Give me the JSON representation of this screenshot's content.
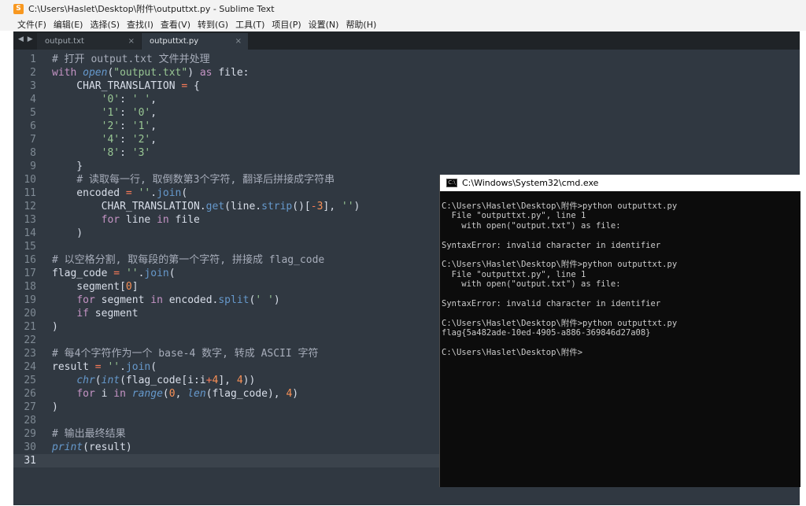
{
  "window": {
    "title": "C:\\Users\\Haslet\\Desktop\\附件\\outputtxt.py - Sublime Text",
    "app_icon_letter": "S"
  },
  "menu": [
    "文件(F)",
    "编辑(E)",
    "选择(S)",
    "查找(I)",
    "查看(V)",
    "转到(G)",
    "工具(T)",
    "项目(P)",
    "设置(N)",
    "帮助(H)"
  ],
  "tabs": [
    {
      "label": "output.txt",
      "close": "×",
      "active": false
    },
    {
      "label": "outputtxt.py",
      "close": "×",
      "active": true
    }
  ],
  "tab_nav": "◀ ▶",
  "editor": {
    "current_line": 31,
    "lines": [
      {
        "n": "1",
        "tokens": [
          [
            "cm",
            "# 打开 output.txt 文件并处理"
          ]
        ]
      },
      {
        "n": "2",
        "tokens": [
          [
            "kw",
            "with"
          ],
          [
            "",
            " "
          ],
          [
            "bi",
            "open"
          ],
          [
            "",
            "("
          ],
          [
            "str",
            "\"output.txt\""
          ],
          [
            "",
            ") "
          ],
          [
            "kw",
            "as"
          ],
          [
            "",
            " file:"
          ]
        ]
      },
      {
        "n": "3",
        "tokens": [
          [
            "",
            "    CHAR_TRANSLATION "
          ],
          [
            "op",
            "="
          ],
          [
            "",
            " {"
          ]
        ]
      },
      {
        "n": "4",
        "tokens": [
          [
            "",
            "        "
          ],
          [
            "str",
            "'0'"
          ],
          [
            "",
            ": "
          ],
          [
            "str",
            "' '"
          ],
          [
            "",
            ","
          ]
        ]
      },
      {
        "n": "5",
        "tokens": [
          [
            "",
            "        "
          ],
          [
            "str",
            "'1'"
          ],
          [
            "",
            ": "
          ],
          [
            "str",
            "'0'"
          ],
          [
            "",
            ","
          ]
        ]
      },
      {
        "n": "6",
        "tokens": [
          [
            "",
            "        "
          ],
          [
            "str",
            "'2'"
          ],
          [
            "",
            ": "
          ],
          [
            "str",
            "'1'"
          ],
          [
            "",
            ","
          ]
        ]
      },
      {
        "n": "7",
        "tokens": [
          [
            "",
            "        "
          ],
          [
            "str",
            "'4'"
          ],
          [
            "",
            ": "
          ],
          [
            "str",
            "'2'"
          ],
          [
            "",
            ","
          ]
        ]
      },
      {
        "n": "8",
        "tokens": [
          [
            "",
            "        "
          ],
          [
            "str",
            "'8'"
          ],
          [
            "",
            ": "
          ],
          [
            "str",
            "'3'"
          ]
        ]
      },
      {
        "n": "9",
        "tokens": [
          [
            "",
            "    }"
          ]
        ]
      },
      {
        "n": "10",
        "tokens": [
          [
            "",
            "    "
          ],
          [
            "cm",
            "# 读取每一行, 取倒数第3个字符, 翻译后拼接成字符串"
          ]
        ]
      },
      {
        "n": "11",
        "tokens": [
          [
            "",
            "    encoded "
          ],
          [
            "op",
            "="
          ],
          [
            "",
            " "
          ],
          [
            "str",
            "''"
          ],
          [
            "",
            "."
          ],
          [
            "fn",
            "join"
          ],
          [
            "",
            "("
          ]
        ]
      },
      {
        "n": "12",
        "tokens": [
          [
            "",
            "        CHAR_TRANSLATION."
          ],
          [
            "fn",
            "get"
          ],
          [
            "",
            "(line."
          ],
          [
            "fn",
            "strip"
          ],
          [
            "",
            "()["
          ],
          [
            "op",
            "-"
          ],
          [
            "num",
            "3"
          ],
          [
            "",
            "], "
          ],
          [
            "str",
            "''"
          ],
          [
            "",
            ")"
          ]
        ]
      },
      {
        "n": "13",
        "tokens": [
          [
            "",
            "        "
          ],
          [
            "kw",
            "for"
          ],
          [
            "",
            " line "
          ],
          [
            "kw",
            "in"
          ],
          [
            "",
            " file"
          ]
        ]
      },
      {
        "n": "14",
        "tokens": [
          [
            "",
            "    )"
          ]
        ]
      },
      {
        "n": "15",
        "tokens": []
      },
      {
        "n": "16",
        "tokens": [
          [
            "cm",
            "# 以空格分割, 取每段的第一个字符, 拼接成 flag_code"
          ]
        ]
      },
      {
        "n": "17",
        "tokens": [
          [
            "",
            "flag_code "
          ],
          [
            "op",
            "="
          ],
          [
            "",
            " "
          ],
          [
            "str",
            "''"
          ],
          [
            "",
            "."
          ],
          [
            "fn",
            "join"
          ],
          [
            "",
            "("
          ]
        ]
      },
      {
        "n": "18",
        "tokens": [
          [
            "",
            "    segment["
          ],
          [
            "num",
            "0"
          ],
          [
            "",
            "]"
          ]
        ]
      },
      {
        "n": "19",
        "tokens": [
          [
            "",
            "    "
          ],
          [
            "kw",
            "for"
          ],
          [
            "",
            " segment "
          ],
          [
            "kw",
            "in"
          ],
          [
            "",
            " encoded."
          ],
          [
            "fn",
            "split"
          ],
          [
            "",
            "("
          ],
          [
            "str",
            "' '"
          ],
          [
            "",
            ")"
          ]
        ]
      },
      {
        "n": "20",
        "tokens": [
          [
            "",
            "    "
          ],
          [
            "kw",
            "if"
          ],
          [
            "",
            " segment"
          ]
        ]
      },
      {
        "n": "21",
        "tokens": [
          [
            "",
            ")"
          ]
        ]
      },
      {
        "n": "22",
        "tokens": []
      },
      {
        "n": "23",
        "tokens": [
          [
            "cm",
            "# 每4个字符作为一个 base-4 数字, 转成 ASCII 字符"
          ]
        ]
      },
      {
        "n": "24",
        "tokens": [
          [
            "",
            "result "
          ],
          [
            "op",
            "="
          ],
          [
            "",
            " "
          ],
          [
            "str",
            "''"
          ],
          [
            "",
            "."
          ],
          [
            "fn",
            "join"
          ],
          [
            "",
            "("
          ]
        ]
      },
      {
        "n": "25",
        "tokens": [
          [
            "",
            "    "
          ],
          [
            "bi",
            "chr"
          ],
          [
            "",
            "("
          ],
          [
            "bi",
            "int"
          ],
          [
            "",
            "(flag_code[i:i"
          ],
          [
            "op",
            "+"
          ],
          [
            "num",
            "4"
          ],
          [
            "",
            "], "
          ],
          [
            "num",
            "4"
          ],
          [
            "",
            "))"
          ]
        ]
      },
      {
        "n": "26",
        "tokens": [
          [
            "",
            "    "
          ],
          [
            "kw",
            "for"
          ],
          [
            "",
            " i "
          ],
          [
            "kw",
            "in"
          ],
          [
            "",
            " "
          ],
          [
            "bi",
            "range"
          ],
          [
            "",
            "("
          ],
          [
            "num",
            "0"
          ],
          [
            "",
            ", "
          ],
          [
            "bi",
            "len"
          ],
          [
            "",
            "(flag_code), "
          ],
          [
            "num",
            "4"
          ],
          [
            "",
            ")"
          ]
        ]
      },
      {
        "n": "27",
        "tokens": [
          [
            "",
            ")"
          ]
        ]
      },
      {
        "n": "28",
        "tokens": []
      },
      {
        "n": "29",
        "tokens": [
          [
            "cm",
            "# 输出最终结果"
          ]
        ]
      },
      {
        "n": "30",
        "tokens": [
          [
            "bi",
            "print"
          ],
          [
            "",
            "(result)"
          ]
        ]
      },
      {
        "n": "31",
        "tokens": []
      }
    ]
  },
  "cmd": {
    "title": "C:\\Windows\\System32\\cmd.exe",
    "lines": [
      "C:\\Users\\Haslet\\Desktop\\附件>python outputtxt.py",
      "  File \"outputtxt.py\", line 1",
      "    with open(\"output.txt\") as file:",
      "",
      "SyntaxError: invalid character in identifier",
      "",
      "C:\\Users\\Haslet\\Desktop\\附件>python outputtxt.py",
      "  File \"outputtxt.py\", line 1",
      "    with open(\"output.txt\") as file:",
      "",
      "SyntaxError: invalid character in identifier",
      "",
      "C:\\Users\\Haslet\\Desktop\\附件>python outputtxt.py",
      "flag{5a482ade-10ed-4905-a886-369846d27a08}",
      "",
      "C:\\Users\\Haslet\\Desktop\\附件>"
    ]
  },
  "colors": {
    "editor_bg": "#303841",
    "keyword": "#c594c5",
    "string": "#99c794",
    "number": "#f99157",
    "function": "#6699cc",
    "comment": "#a7adba",
    "cmd_bg": "#0c0c0c",
    "cmd_text": "#cccccc"
  }
}
